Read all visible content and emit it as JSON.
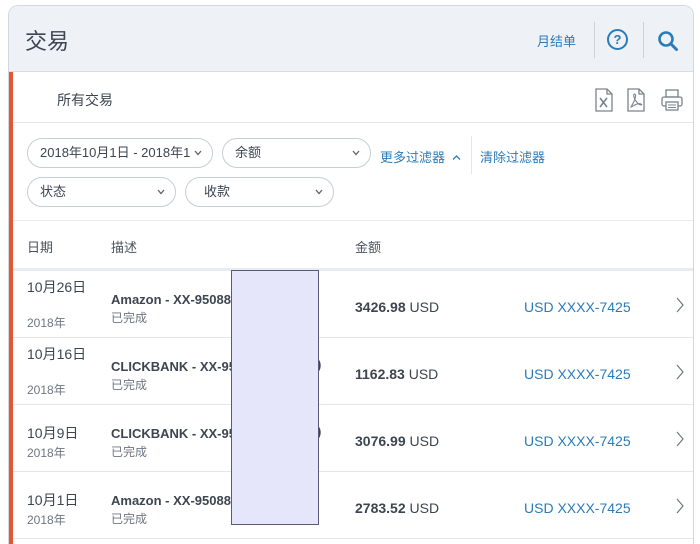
{
  "header": {
    "title": "交易",
    "statement_link": "月结单",
    "help_label": "?"
  },
  "sub": {
    "title": "所有交易"
  },
  "filters": {
    "date_range": "2018年10月1日 - 2018年1",
    "amount": "余额",
    "more_filters": "更多过滤器",
    "clear_filters": "清除过滤器",
    "status": "状态",
    "type": "收款"
  },
  "columns": {
    "date": "日期",
    "description": "描述",
    "amount": "金额"
  },
  "rows": [
    {
      "date": "10月26日",
      "year": "2018年",
      "description": "Amazon - XX-95088",
      "status": "已完成",
      "amount": "3426.98",
      "currency": "USD",
      "account": "USD XXXX-7425"
    },
    {
      "date": "10月16日",
      "year": "2018年",
      "description": "CLICKBANK - XX-95",
      "status": "已完成",
      "amount": "1162.83",
      "currency": "USD",
      "account": "USD XXXX-7425",
      "suffix": ")"
    },
    {
      "date": "10月9日",
      "year": "2018年",
      "description": "CLICKBANK - XX-95",
      "status": "已完成",
      "amount": "3076.99",
      "currency": "USD",
      "account": "USD XXXX-7425",
      "suffix": ")"
    },
    {
      "date": "10月1日",
      "year": "2018年",
      "description": "Amazon - XX-95088",
      "status": "已完成",
      "amount": "2783.52",
      "currency": "USD",
      "account": "USD XXXX-7425"
    }
  ],
  "colors": {
    "accent": "#e3582d",
    "link": "#2b7bb9"
  }
}
